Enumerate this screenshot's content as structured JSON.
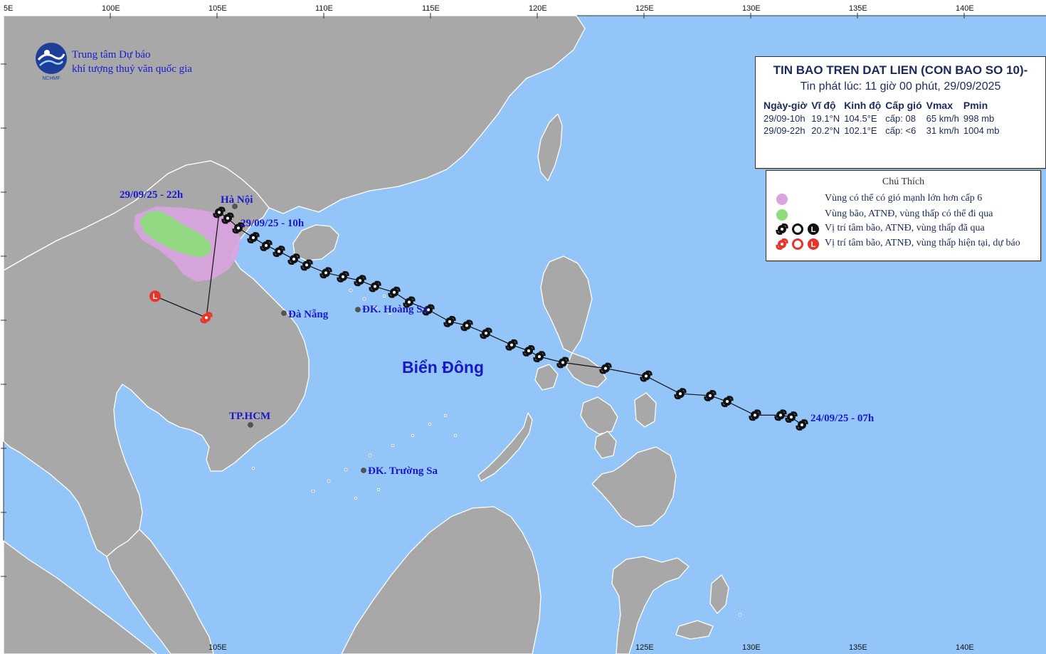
{
  "agency": {
    "line1": "Trung tâm Dự báo",
    "line2": "khí tượng thuỷ văn quốc gia",
    "logo_text": "NCHMF"
  },
  "axis": {
    "lon_top": [
      "5E",
      "100E",
      "105E",
      "110E",
      "115E",
      "120E",
      "125E",
      "130E",
      "135E",
      "140E"
    ],
    "lon_bottom": [
      "105E",
      "125E",
      "130E",
      "135E",
      "140E"
    ]
  },
  "info": {
    "title": "TIN BAO TREN DAT LIEN (CON BAO SO 10)-",
    "issued": "Tin phát lúc: 11 giờ 00 phút, 29/09/2025",
    "headers": [
      "Ngày-giờ",
      "Vĩ độ",
      "Kinh độ",
      "Cấp gió",
      "Vmax",
      "Pmin"
    ],
    "rows": [
      [
        "29/09-10h",
        "19.1°N",
        "104.5°E",
        "cấp: 08",
        "65 km/h",
        "998 mb"
      ],
      [
        "29/09-22h",
        "20.2°N",
        "102.1°E",
        "cấp: <6",
        "31 km/h",
        "1004 mb"
      ]
    ]
  },
  "legend": {
    "title": "Chú Thích",
    "items": [
      {
        "text": "Vùng có thể có gió mạnh lớn hơn cấp 6",
        "color": "#d9a3e0"
      },
      {
        "text": "Vùng bão, ATNĐ, vùng thấp có thể đi qua",
        "color": "#8fdc7e"
      },
      {
        "text": "Vị trí tâm bão, ATNĐ, vùng thấp đã qua",
        "color": "#111111"
      },
      {
        "text": "Vị trí tâm bão, ATNĐ, vùng thấp hiện tại, dự báo",
        "color": "#e8352a"
      }
    ]
  },
  "labels": {
    "forecast_time": "29/09/25 - 22h",
    "current_time": "29/09/25 - 10h",
    "start_time": "24/09/25 - 07h",
    "hanoi": "Hà Nội",
    "danang": "Đà Nẵng",
    "hoangsa": "ĐK. Hoàng Sa",
    "hcm": "TP.HCM",
    "truongsa": "ĐK. Trường Sa",
    "sea": "Biển Đông"
  },
  "colors": {
    "ocean": "#94c5f8",
    "land": "#a8a8a8",
    "track": "#111111",
    "current": "#e8352a",
    "wind_zone": "#d9a3e0",
    "storm_zone": "#8fdc7e",
    "label_blue": "#1a1acc"
  },
  "storm": {
    "past_track": [
      {
        "lon": 132.4,
        "lat": 13.6
      },
      {
        "lon": 131.9,
        "lat": 14.0
      },
      {
        "lon": 131.4,
        "lat": 14.1
      },
      {
        "lon": 130.2,
        "lat": 14.1
      },
      {
        "lon": 128.9,
        "lat": 14.8
      },
      {
        "lon": 128.1,
        "lat": 15.1
      },
      {
        "lon": 126.7,
        "lat": 15.2
      },
      {
        "lon": 125.1,
        "lat": 16.1
      },
      {
        "lon": 123.2,
        "lat": 16.5
      },
      {
        "lon": 121.2,
        "lat": 16.8
      },
      {
        "lon": 120.1,
        "lat": 17.1
      },
      {
        "lon": 119.6,
        "lat": 17.4
      },
      {
        "lon": 118.8,
        "lat": 17.7
      },
      {
        "lon": 117.6,
        "lat": 18.3
      },
      {
        "lon": 116.7,
        "lat": 18.7
      },
      {
        "lon": 115.9,
        "lat": 18.9
      },
      {
        "lon": 114.9,
        "lat": 19.5
      },
      {
        "lon": 114.0,
        "lat": 19.9
      },
      {
        "lon": 113.3,
        "lat": 20.4
      },
      {
        "lon": 112.4,
        "lat": 20.7
      },
      {
        "lon": 111.7,
        "lat": 21.0
      },
      {
        "lon": 110.9,
        "lat": 21.2
      },
      {
        "lon": 110.1,
        "lat": 21.4
      },
      {
        "lon": 109.2,
        "lat": 21.8
      },
      {
        "lon": 108.6,
        "lat": 22.1
      },
      {
        "lon": 107.9,
        "lat": 22.5
      },
      {
        "lon": 107.3,
        "lat": 22.8
      },
      {
        "lon": 106.7,
        "lat": 23.2
      },
      {
        "lon": 106.0,
        "lat": 23.7
      },
      {
        "lon": 105.5,
        "lat": 24.2
      },
      {
        "lon": 105.1,
        "lat": 24.5
      }
    ],
    "current": {
      "lon": 104.5,
      "lat": 19.1
    },
    "forecast": {
      "lon": 102.1,
      "lat": 20.2
    }
  }
}
